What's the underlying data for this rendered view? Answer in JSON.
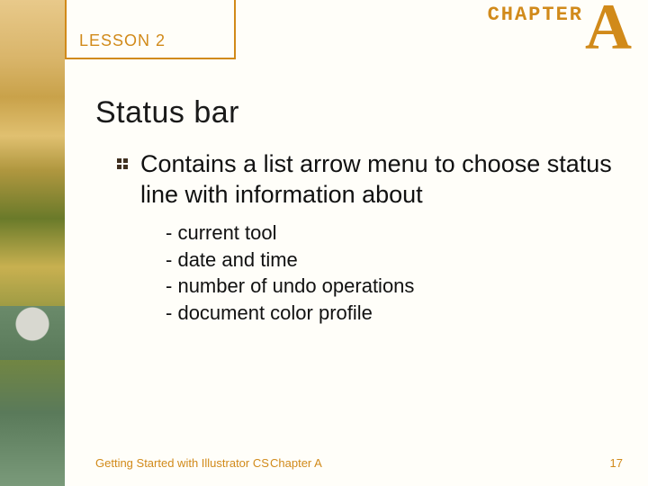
{
  "header": {
    "lesson_label": "LESSON 2",
    "chapter_word": "CHAPTER",
    "chapter_letter": "A"
  },
  "title": "Status bar",
  "bullet_text": "Contains a list arrow menu to choose status line with information about",
  "sub_items": [
    "current tool",
    "date and time",
    "number of undo operations",
    "document color profile"
  ],
  "footer": {
    "left": "Getting Started with Illustrator CS",
    "center": "Chapter A",
    "right": "17"
  },
  "colors": {
    "accent": "#d18a1a"
  }
}
